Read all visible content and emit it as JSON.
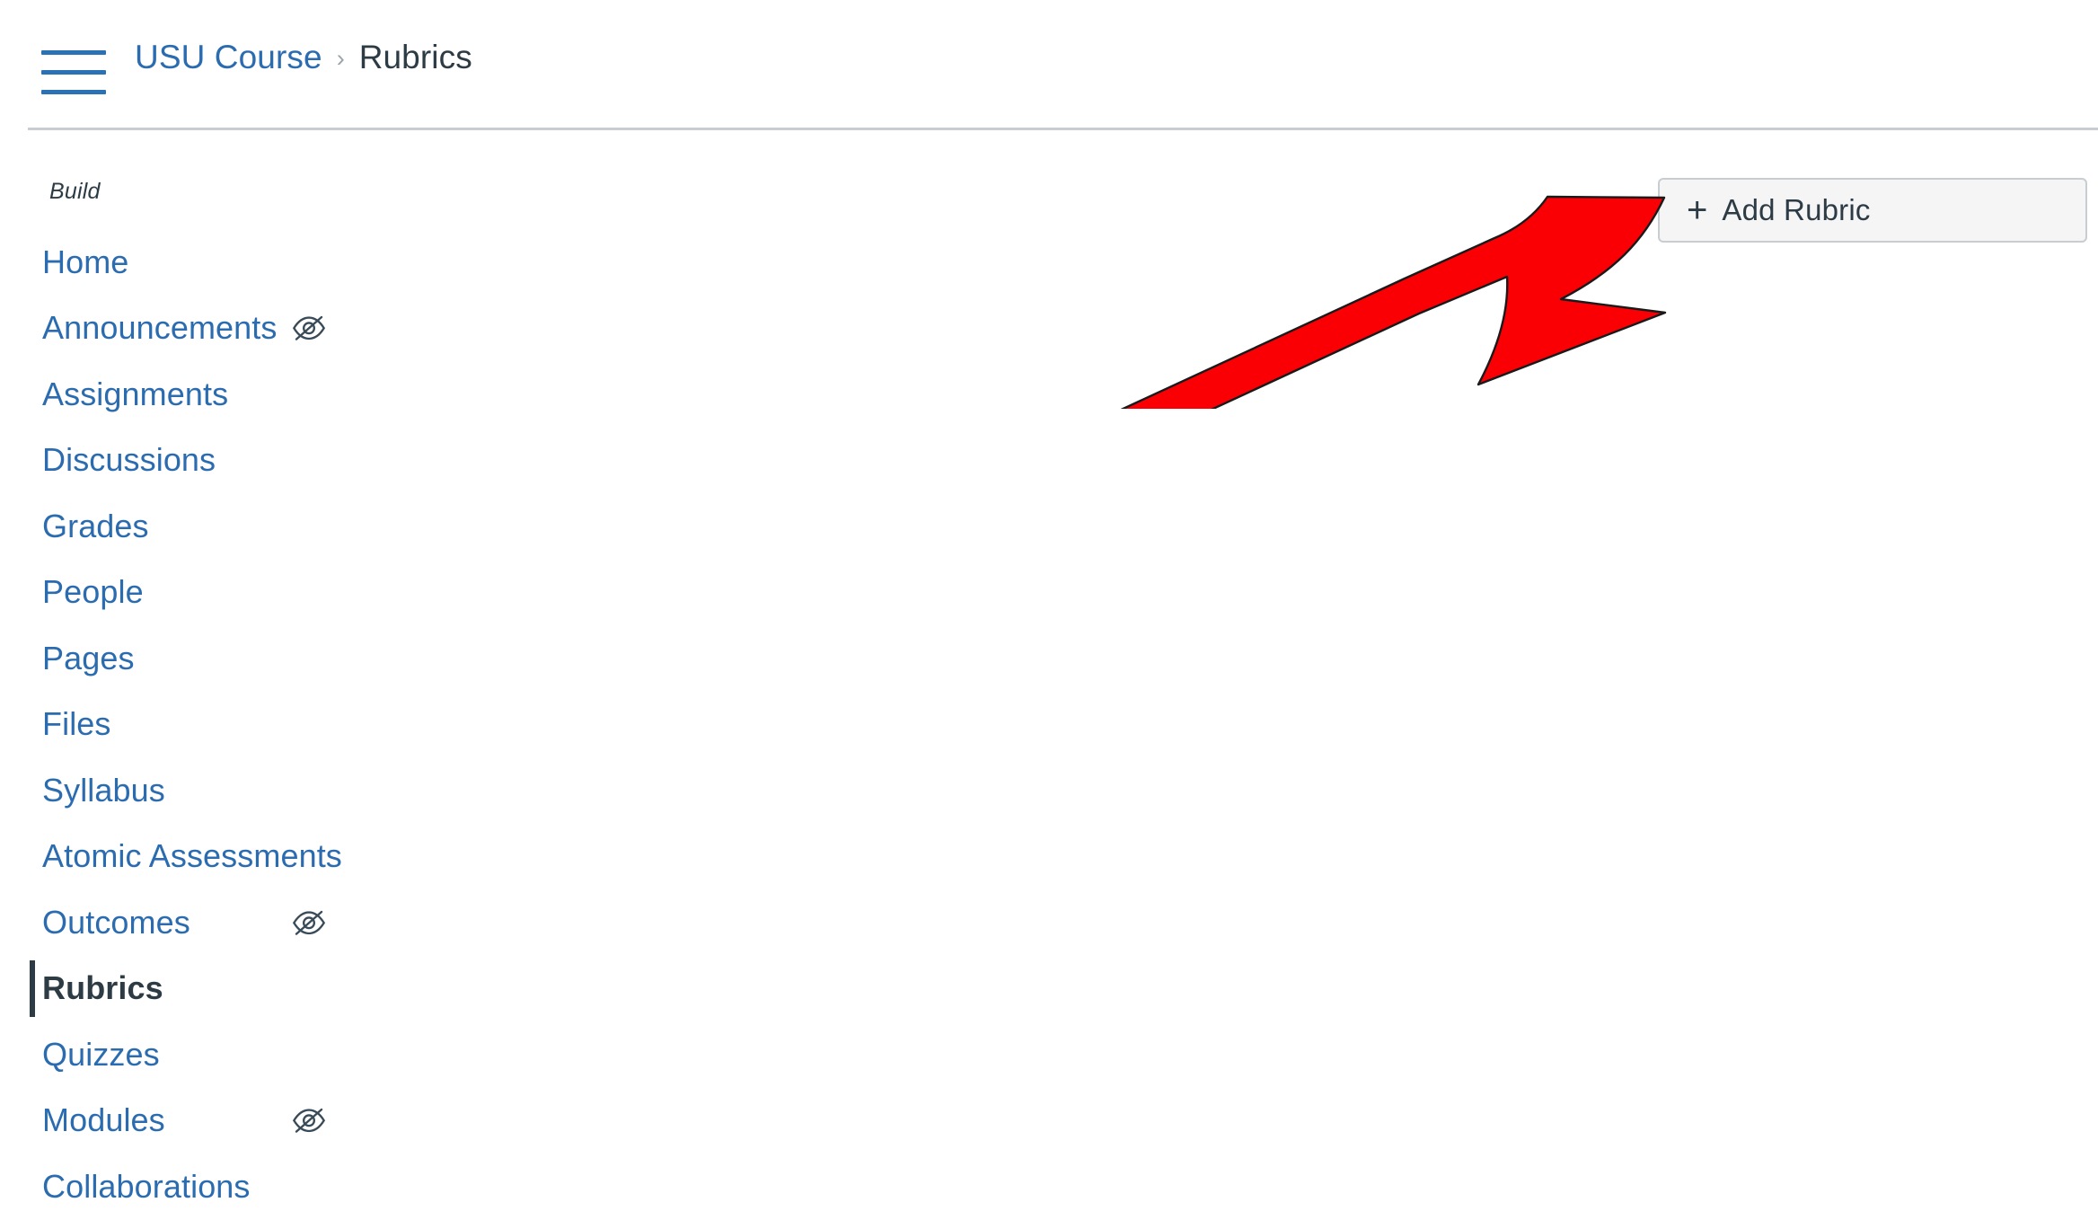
{
  "header": {
    "menu_icon": "hamburger-menu-icon",
    "breadcrumb": {
      "course_label": "USU Course",
      "separator": "›",
      "current_page": "Rubrics"
    }
  },
  "sidebar": {
    "section_label": "Build",
    "items": [
      {
        "label": "Home",
        "hidden_from_students": false,
        "active": false
      },
      {
        "label": "Announcements",
        "hidden_from_students": true,
        "active": false
      },
      {
        "label": "Assignments",
        "hidden_from_students": false,
        "active": false
      },
      {
        "label": "Discussions",
        "hidden_from_students": false,
        "active": false
      },
      {
        "label": "Grades",
        "hidden_from_students": false,
        "active": false
      },
      {
        "label": "People",
        "hidden_from_students": false,
        "active": false
      },
      {
        "label": "Pages",
        "hidden_from_students": false,
        "active": false
      },
      {
        "label": "Files",
        "hidden_from_students": false,
        "active": false
      },
      {
        "label": "Syllabus",
        "hidden_from_students": false,
        "active": false
      },
      {
        "label": "Atomic Assessments",
        "hidden_from_students": false,
        "active": false
      },
      {
        "label": "Outcomes",
        "hidden_from_students": true,
        "active": false
      },
      {
        "label": "Rubrics",
        "hidden_from_students": false,
        "active": true
      },
      {
        "label": "Quizzes",
        "hidden_from_students": false,
        "active": false
      },
      {
        "label": "Modules",
        "hidden_from_students": true,
        "active": false
      },
      {
        "label": "Collaborations",
        "hidden_from_students": false,
        "active": false
      }
    ],
    "hidden_icon_name": "eye-slash-icon"
  },
  "main": {
    "add_rubric_button": {
      "plus_glyph": "+",
      "label": "Add Rubric"
    }
  },
  "annotation": {
    "arrow_name": "red-pointer-arrow",
    "points_to": "Add Rubric"
  },
  "colors": {
    "link_blue": "#2B6CB0",
    "text_dark": "#2D3B45",
    "border_gray": "#C7CDD1",
    "button_fill": "#F5F5F5",
    "annotation_red": "#FA0005"
  }
}
